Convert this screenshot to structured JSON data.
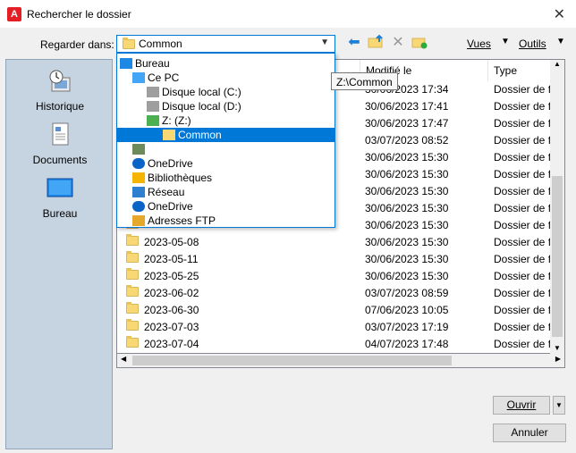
{
  "window": {
    "title": "Rechercher le dossier",
    "app_icon_text": "A"
  },
  "lookin": {
    "label": "Regarder dans:",
    "value": "Common"
  },
  "toolbar": {
    "views_label": "Vues",
    "tools_label": "Outils"
  },
  "places": [
    {
      "label": "Historique",
      "icon": "history-icon"
    },
    {
      "label": "Documents",
      "icon": "documents-icon"
    },
    {
      "label": "Bureau",
      "icon": "desktop-icon"
    }
  ],
  "columns": {
    "modified": "Modifié le",
    "type": "Type"
  },
  "rows": [
    {
      "name": "",
      "modified": "30/06/2023 17:34",
      "type": "Dossier de fi"
    },
    {
      "name": "",
      "modified": "30/06/2023 17:41",
      "type": "Dossier de fi"
    },
    {
      "name": "",
      "modified": "30/06/2023 17:47",
      "type": "Dossier de fi"
    },
    {
      "name": "",
      "modified": "03/07/2023 08:52",
      "type": "Dossier de fi"
    },
    {
      "name": "",
      "modified": "30/06/2023 15:30",
      "type": "Dossier de fi"
    },
    {
      "name": "",
      "modified": "30/06/2023 15:30",
      "type": "Dossier de fi"
    },
    {
      "name": "",
      "modified": "30/06/2023 15:30",
      "type": "Dossier de fi"
    },
    {
      "name": "",
      "modified": "30/06/2023 15:30",
      "type": "Dossier de fi"
    },
    {
      "name": "",
      "modified": "30/06/2023 15:30",
      "type": "Dossier de fi"
    },
    {
      "name": "2023-05-08",
      "modified": "30/06/2023 15:30",
      "type": "Dossier de fi"
    },
    {
      "name": "2023-05-11",
      "modified": "30/06/2023 15:30",
      "type": "Dossier de fi"
    },
    {
      "name": "2023-05-25",
      "modified": "30/06/2023 15:30",
      "type": "Dossier de fi"
    },
    {
      "name": "2023-06-02",
      "modified": "03/07/2023 08:59",
      "type": "Dossier de fi"
    },
    {
      "name": "2023-06-30",
      "modified": "07/06/2023 10:05",
      "type": "Dossier de fi"
    },
    {
      "name": "2023-07-03",
      "modified": "03/07/2023 17:19",
      "type": "Dossier de fi"
    },
    {
      "name": "2023-07-04",
      "modified": "04/07/2023 17:48",
      "type": "Dossier de fi"
    }
  ],
  "dropdown": [
    {
      "label": "Bureau",
      "icon": "desktop-icon",
      "level": 0
    },
    {
      "label": "Ce PC",
      "icon": "computer-icon",
      "level": 1
    },
    {
      "label": "Disque local (C:)",
      "icon": "drive-icon",
      "level": 2
    },
    {
      "label": "Disque local (D:)",
      "icon": "drive-icon",
      "level": 2
    },
    {
      "label": "Z: (Z:)",
      "icon": "network-drive-icon",
      "level": 2
    },
    {
      "label": "Common",
      "icon": "folder-icon",
      "level": 3,
      "selected": true
    },
    {
      "label": "",
      "icon": "user-icon",
      "level": 1
    },
    {
      "label": "OneDrive",
      "icon": "onedrive-icon",
      "level": 1
    },
    {
      "label": "Bibliothèques",
      "icon": "libraries-icon",
      "level": 1
    },
    {
      "label": "Réseau",
      "icon": "network-icon",
      "level": 1
    },
    {
      "label": "OneDrive",
      "icon": "onedrive-icon",
      "level": 1
    },
    {
      "label": "Adresses FTP",
      "icon": "ftp-icon",
      "level": 1
    }
  ],
  "tooltip": "Z:\\Common",
  "buttons": {
    "open": "Ouvrir",
    "cancel": "Annuler"
  }
}
